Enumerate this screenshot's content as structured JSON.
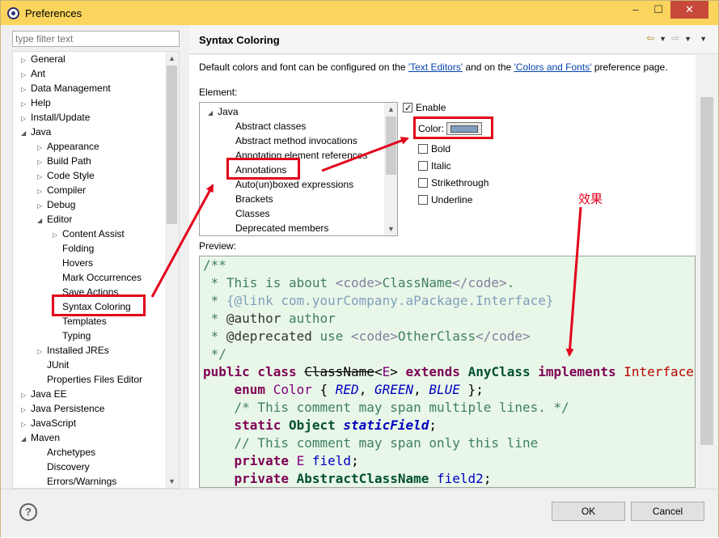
{
  "window": {
    "title": "Preferences"
  },
  "filter": {
    "placeholder": "type filter text"
  },
  "tree": [
    {
      "label": "General",
      "depth": 0,
      "twisty": "closed"
    },
    {
      "label": "Ant",
      "depth": 0,
      "twisty": "closed"
    },
    {
      "label": "Data Management",
      "depth": 0,
      "twisty": "closed"
    },
    {
      "label": "Help",
      "depth": 0,
      "twisty": "closed"
    },
    {
      "label": "Install/Update",
      "depth": 0,
      "twisty": "closed"
    },
    {
      "label": "Java",
      "depth": 0,
      "twisty": "open"
    },
    {
      "label": "Appearance",
      "depth": 1,
      "twisty": "closed"
    },
    {
      "label": "Build Path",
      "depth": 1,
      "twisty": "closed"
    },
    {
      "label": "Code Style",
      "depth": 1,
      "twisty": "closed"
    },
    {
      "label": "Compiler",
      "depth": 1,
      "twisty": "closed"
    },
    {
      "label": "Debug",
      "depth": 1,
      "twisty": "closed"
    },
    {
      "label": "Editor",
      "depth": 1,
      "twisty": "open"
    },
    {
      "label": "Content Assist",
      "depth": 2,
      "twisty": "closed"
    },
    {
      "label": "Folding",
      "depth": 2,
      "twisty": "none"
    },
    {
      "label": "Hovers",
      "depth": 2,
      "twisty": "none"
    },
    {
      "label": "Mark Occurrences",
      "depth": 2,
      "twisty": "none"
    },
    {
      "label": "Save Actions",
      "depth": 2,
      "twisty": "none"
    },
    {
      "label": "Syntax Coloring",
      "depth": 2,
      "twisty": "none"
    },
    {
      "label": "Templates",
      "depth": 2,
      "twisty": "none"
    },
    {
      "label": "Typing",
      "depth": 2,
      "twisty": "none"
    },
    {
      "label": "Installed JREs",
      "depth": 1,
      "twisty": "closed"
    },
    {
      "label": "JUnit",
      "depth": 1,
      "twisty": "none"
    },
    {
      "label": "Properties Files Editor",
      "depth": 1,
      "twisty": "none"
    },
    {
      "label": "Java EE",
      "depth": 0,
      "twisty": "closed"
    },
    {
      "label": "Java Persistence",
      "depth": 0,
      "twisty": "closed"
    },
    {
      "label": "JavaScript",
      "depth": 0,
      "twisty": "closed"
    },
    {
      "label": "Maven",
      "depth": 0,
      "twisty": "open"
    },
    {
      "label": "Archetypes",
      "depth": 1,
      "twisty": "none"
    },
    {
      "label": "Discovery",
      "depth": 1,
      "twisty": "none"
    },
    {
      "label": "Errors/Warnings",
      "depth": 1,
      "twisty": "none"
    }
  ],
  "page": {
    "title": "Syntax Coloring",
    "desc_pre": "Default colors and font can be configured on the ",
    "link1": "'Text Editors'",
    "desc_mid": " and on the ",
    "link2": "'Colors and Fonts'",
    "desc_post": " preference page.",
    "element_label": "Element:",
    "preview_label": "Preview:"
  },
  "elements": [
    "Java",
    "Abstract classes",
    "Abstract method invocations",
    "Annotation element references",
    "Annotations",
    "Auto(un)boxed expressions",
    "Brackets",
    "Classes",
    "Deprecated members"
  ],
  "options": {
    "enable": "Enable",
    "color": "Color:",
    "bold": "Bold",
    "italic": "Italic",
    "strikethrough": "Strikethrough",
    "underline": "Underline"
  },
  "colors": {
    "annotation_swatch": "#7f9fbf",
    "highlight": "#e2001a"
  },
  "annotation_text": "效果",
  "buttons": {
    "help": "?",
    "ok": "OK",
    "cancel": "Cancel"
  }
}
